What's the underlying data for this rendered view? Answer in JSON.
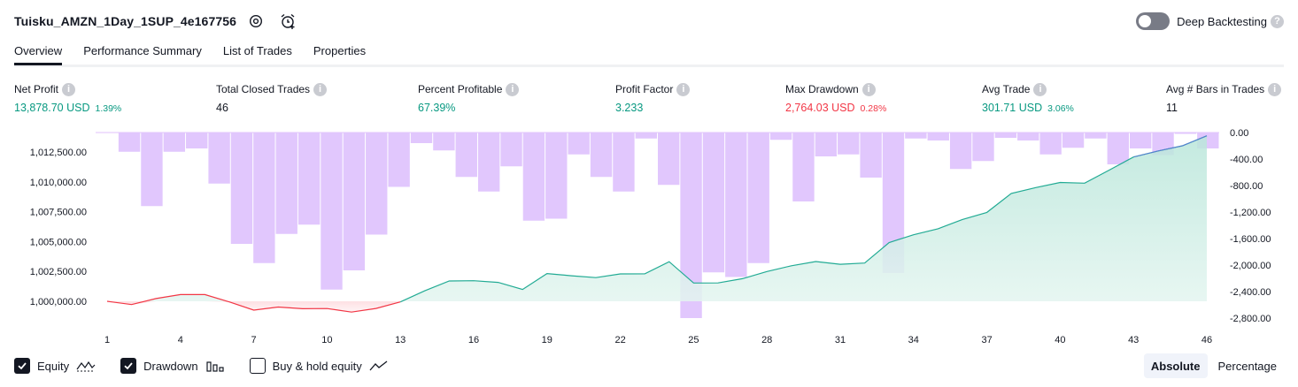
{
  "header": {
    "strategy_name": "Tuisku_AMZN_1Day_1SUP_4e167756",
    "settings_icon": "settings-gear-icon",
    "alert_icon": "alarm-clock-add-icon"
  },
  "deep_backtesting": {
    "label": "Deep Backtesting",
    "enabled": false
  },
  "tabs": [
    {
      "label": "Overview",
      "active": true
    },
    {
      "label": "Performance Summary",
      "active": false
    },
    {
      "label": "List of Trades",
      "active": false
    },
    {
      "label": "Properties",
      "active": false
    }
  ],
  "metrics": [
    {
      "label": "Net Profit",
      "value": "13,878.70 USD",
      "pct": "1.39%",
      "color": "green"
    },
    {
      "label": "Total Closed Trades",
      "value": "46",
      "pct": "",
      "color": "black"
    },
    {
      "label": "Percent Profitable",
      "value": "67.39%",
      "pct": "",
      "color": "green"
    },
    {
      "label": "Profit Factor",
      "value": "3.233",
      "pct": "",
      "color": "green"
    },
    {
      "label": "Max Drawdown",
      "value": "2,764.03 USD",
      "pct": "0.28%",
      "color": "red"
    },
    {
      "label": "Avg Trade",
      "value": "301.71 USD",
      "pct": "3.06%",
      "color": "green"
    },
    {
      "label": "Avg # Bars in Trades",
      "value": "11",
      "pct": "",
      "color": "black"
    }
  ],
  "chart_data": {
    "type": "bar+area",
    "x_ticks": [
      "1",
      "4",
      "7",
      "10",
      "13",
      "16",
      "19",
      "22",
      "25",
      "28",
      "31",
      "34",
      "37",
      "40",
      "43",
      "46"
    ],
    "left_axis": {
      "ticks": [
        "1,012,500.00",
        "1,010,000.00",
        "1,007,500.00",
        "1,005,000.00",
        "1,002,500.00",
        "1,000,000.00"
      ],
      "ylim": [
        998600,
        1013850
      ]
    },
    "right_axis": {
      "ticks": [
        "0.00",
        "-400.00",
        "-800.00",
        "-1,200.00",
        "-1,600.00",
        "-2,000.00",
        "-2,400.00",
        "-2,800.00"
      ],
      "ylim": [
        -2800,
        0
      ]
    },
    "series": [
      {
        "name": "Equity",
        "baseline": 1000000,
        "values": [
          1000000,
          999730,
          1000230,
          1000560,
          1000560,
          999950,
          999260,
          999520,
          999380,
          999390,
          999100,
          999400,
          999950,
          1000880,
          1001700,
          1001720,
          1001580,
          1000990,
          1002320,
          1002140,
          1001980,
          1002290,
          1002300,
          1003310,
          1001530,
          1001540,
          1001890,
          1002490,
          1002970,
          1003330,
          1003100,
          1003200,
          1004920,
          1005570,
          1006070,
          1006850,
          1007440,
          1009030,
          1009520,
          1009950,
          1009890,
          1010980,
          1012080,
          1012580,
          1013020,
          1013850
        ]
      },
      {
        "name": "Drawdown",
        "values": [
          0,
          -290,
          -1110,
          -290,
          -240,
          -770,
          -1680,
          -1970,
          -1530,
          -1390,
          -2370,
          -2080,
          -1540,
          -820,
          -160,
          -270,
          -670,
          -890,
          -510,
          -1330,
          -1300,
          -330,
          -670,
          -890,
          -90,
          -790,
          -2800,
          -2110,
          -2180,
          -1970,
          -110,
          -1040,
          -360,
          -330,
          -680,
          -2120,
          -90,
          -120,
          -550,
          -430,
          -80,
          -120,
          -330,
          -230,
          -90,
          -480,
          -240,
          -340,
          -20,
          -240
        ]
      }
    ]
  },
  "legend": [
    {
      "label": "Equity",
      "checked": true,
      "icon": "equity-line-icon"
    },
    {
      "label": "Drawdown",
      "checked": true,
      "icon": "drawdown-bars-icon"
    },
    {
      "label": "Buy & hold equity",
      "checked": false,
      "icon": "buy-hold-line-icon"
    }
  ],
  "mode": {
    "absolute": "Absolute",
    "percentage": "Percentage",
    "selected": "absolute"
  },
  "colors": {
    "accent": "#131722",
    "green": "#089981",
    "red": "#f23645",
    "drawdown_bar": "#e1c7fd",
    "equity_fill": "#d6f0ea",
    "equity_line": "#22ab94"
  }
}
